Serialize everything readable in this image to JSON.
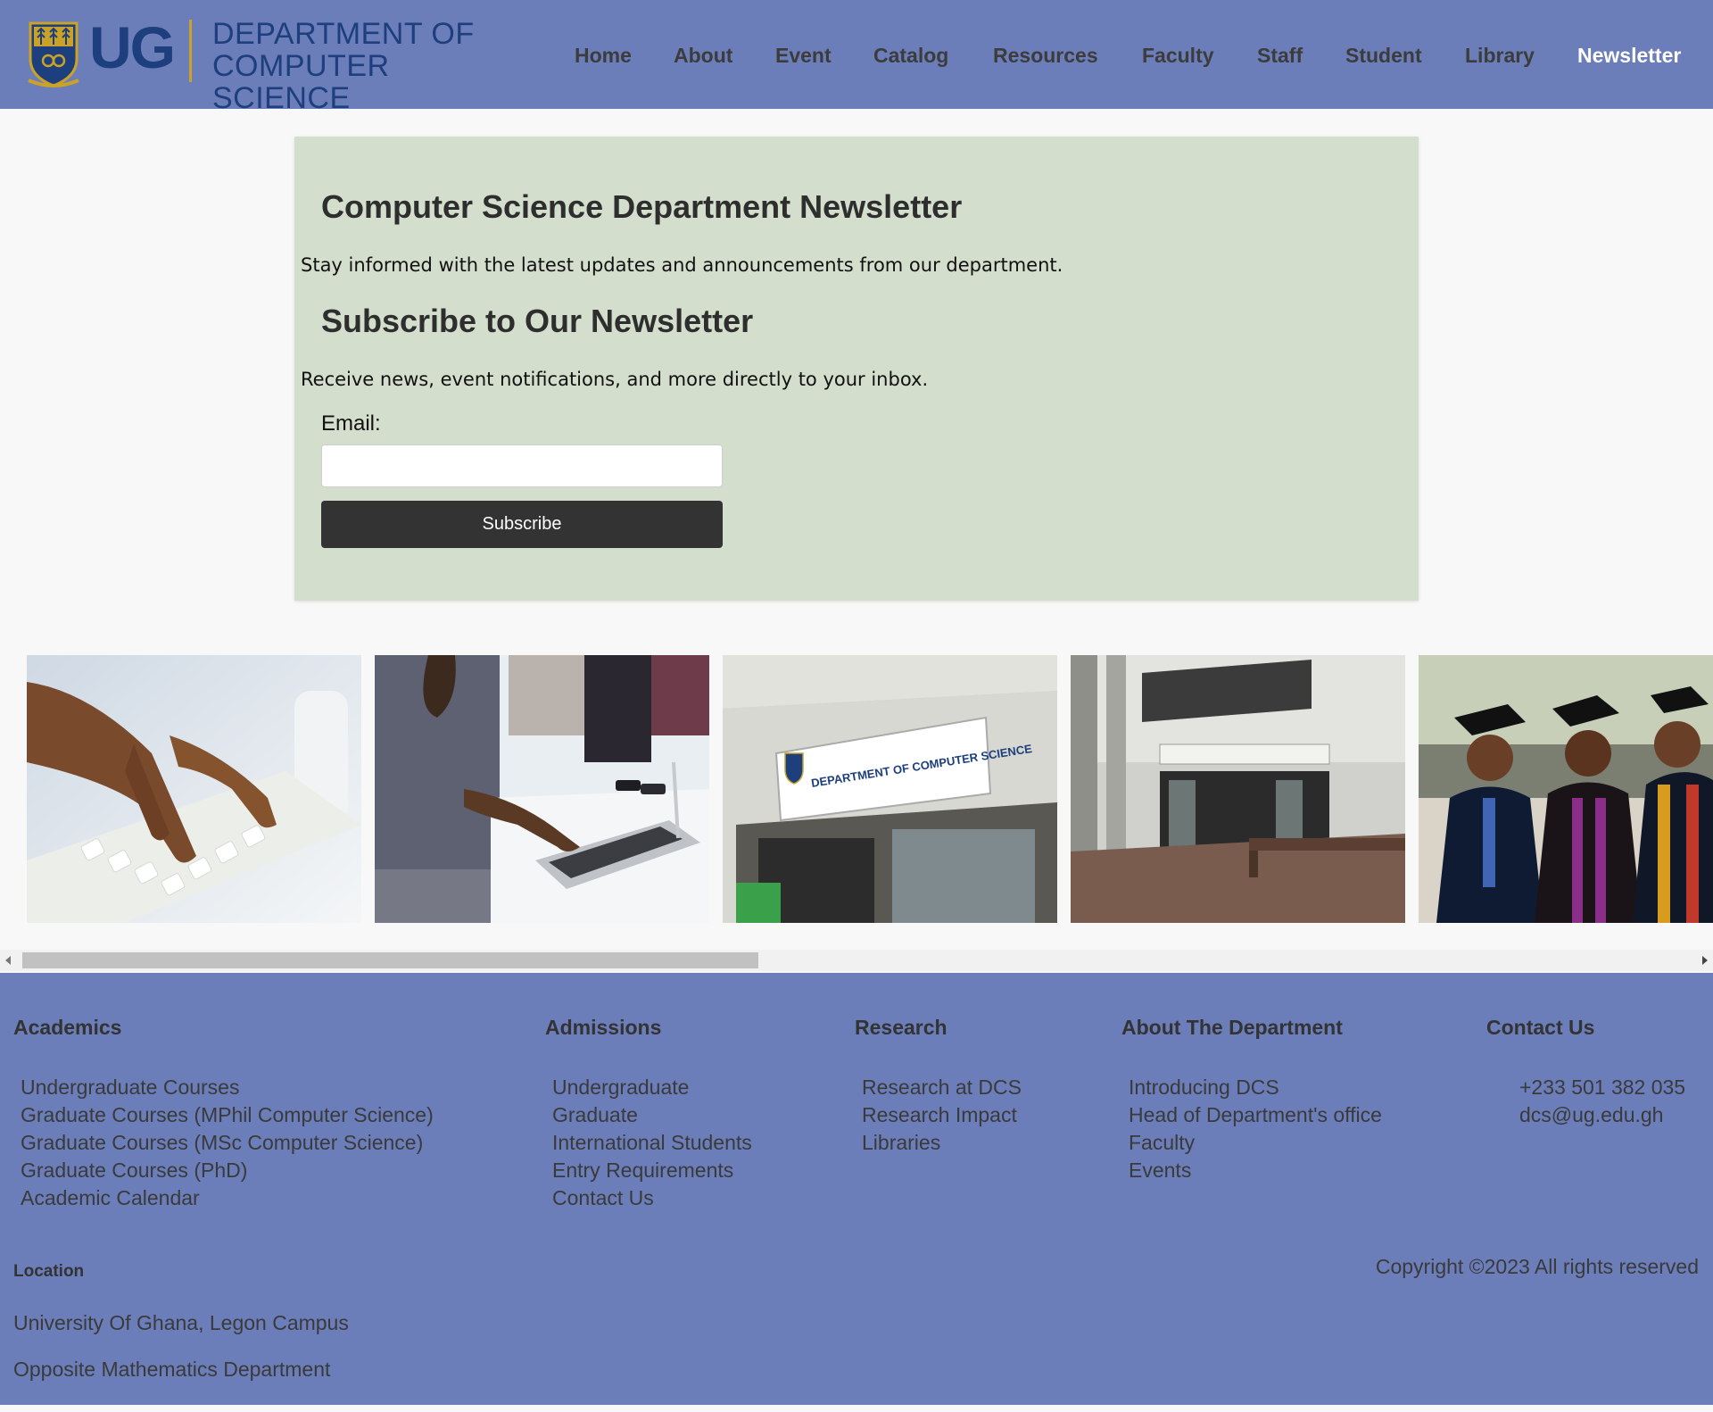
{
  "header": {
    "logo_ug": "UG",
    "logo_line1": "DEPARTMENT OF",
    "logo_line2": "COMPUTER SCIENCE",
    "nav": [
      {
        "label": "Home"
      },
      {
        "label": "About"
      },
      {
        "label": "Event"
      },
      {
        "label": "Catalog"
      },
      {
        "label": "Resources"
      },
      {
        "label": "Faculty"
      },
      {
        "label": "Staff"
      },
      {
        "label": "Student"
      },
      {
        "label": "Library"
      },
      {
        "label": "Newsletter",
        "active": true
      }
    ]
  },
  "newsletter": {
    "title": "Computer Science Department Newsletter",
    "intro": "Stay informed with the latest updates and announcements from our department.",
    "subscribe_title": "Subscribe to Our Newsletter",
    "subscribe_text": "Receive news, event notifications, and more directly to your inbox.",
    "email_label": "Email:",
    "email_value": "",
    "subscribe_button": "Subscribe"
  },
  "gallery": {
    "images": [
      {
        "name": "hands-typing-keyboard-photo"
      },
      {
        "name": "student-laptop-photo"
      },
      {
        "name": "department-sign-photo"
      },
      {
        "name": "department-building-photo"
      },
      {
        "name": "graduates-photo"
      }
    ],
    "department_sign": "DEPARTMENT OF COMPUTER SCIENCE"
  },
  "footer": {
    "academics": {
      "title": "Academics",
      "items": [
        "Undergraduate Courses",
        "Graduate Courses (MPhil Computer Science)",
        "Graduate Courses (MSc Computer Science)",
        "Graduate Courses (PhD)",
        "Academic Calendar"
      ]
    },
    "admissions": {
      "title": "Admissions",
      "items": [
        "Undergraduate",
        "Graduate",
        "International Students",
        "Entry Requirements",
        "Contact Us"
      ]
    },
    "research": {
      "title": "Research",
      "items": [
        "Research at DCS",
        "Research Impact",
        "Libraries"
      ]
    },
    "about": {
      "title": "About The Department",
      "items": [
        "Introducing DCS",
        "Head of Department's office",
        "Faculty",
        "Events"
      ]
    },
    "contact": {
      "title": "Contact Us",
      "items": [
        "+233 501 382 035",
        "dcs@ug.edu.gh"
      ]
    },
    "location_title": "Location",
    "location_line1": "University Of Ghana, Legon Campus",
    "location_line2": "Opposite Mathematics Department",
    "copyright": "Copyright ©2023 All rights reserved"
  },
  "colors": {
    "header_bg": "#6b7eba",
    "panel_bg": "#d3decd",
    "button_bg": "#333333",
    "logo_blue": "#1d3f7d"
  }
}
